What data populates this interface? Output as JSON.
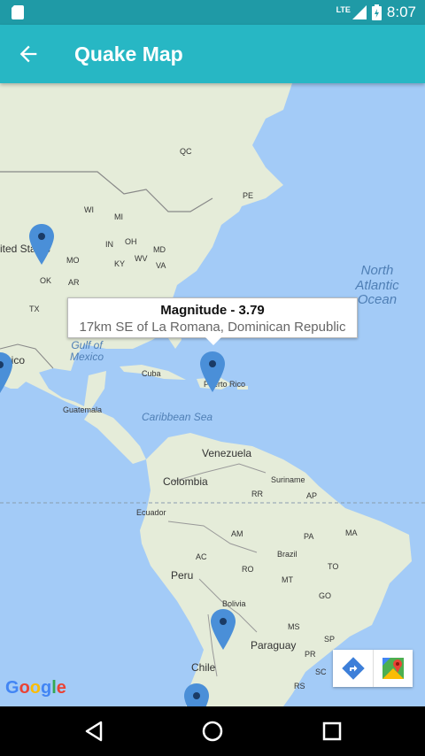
{
  "status_bar": {
    "time": "8:07",
    "network": "LTE",
    "icons": [
      "sd-card-icon",
      "signal-icon",
      "battery-icon"
    ]
  },
  "app_bar": {
    "title": "Quake Map",
    "back_icon": "arrow-back-icon"
  },
  "map": {
    "labels": {
      "qc": "QC",
      "pe": "PE",
      "wi": "WI",
      "mi": "MI",
      "united_states": "ited States",
      "in": "IN",
      "oh": "OH",
      "md": "MD",
      "mo": "MO",
      "ky": "KY",
      "wv": "WV",
      "va": "VA",
      "ok": "OK",
      "ar": "AR",
      "tx": "TX",
      "mexico": "exico",
      "cuba": "Cuba",
      "puerto_rico": "Puerto Rico",
      "guatemala": "Guatemala",
      "venezuela": "Venezuela",
      "colombia": "Colombia",
      "suriname": "Suriname",
      "rr": "RR",
      "ap": "AP",
      "ecuador": "Ecuador",
      "am": "AM",
      "pa": "PA",
      "ma": "MA",
      "ac": "AC",
      "brazil": "Brazil",
      "to": "TO",
      "peru": "Peru",
      "ro": "RO",
      "mt": "MT",
      "go": "GO",
      "bolivia": "Bolivia",
      "ms": "MS",
      "sp": "SP",
      "paraguay": "Paraguay",
      "pr": "PR",
      "sc": "SC",
      "chile": "Chile",
      "rs": "RS"
    },
    "oceans": {
      "north_atlantic": "North Atlantic Ocean",
      "gulf_of_mexico": "Gulf of Mexico",
      "caribbean_sea": "Caribbean Sea"
    },
    "info_window": {
      "title": "Magnitude - 3.79",
      "snippet": "17km SE of La Romana, Dominican Republic"
    },
    "markers": [
      "marker-oklahoma",
      "marker-mexico",
      "marker-puerto-rico",
      "marker-chile",
      "marker-chile-south"
    ],
    "attribution": "Google"
  },
  "map_tools": {
    "directions_icon": "directions-icon",
    "open_maps_icon": "google-maps-icon"
  },
  "nav_bar": {
    "icons": [
      "back-triangle-icon",
      "home-circle-icon",
      "recents-square-icon"
    ]
  },
  "colors": {
    "status_bar": "#1f9aa6",
    "app_bar": "#27b7c4",
    "water": "#a3cbf7",
    "land": "#e5ecd9",
    "marker": "#4a8fd8"
  }
}
